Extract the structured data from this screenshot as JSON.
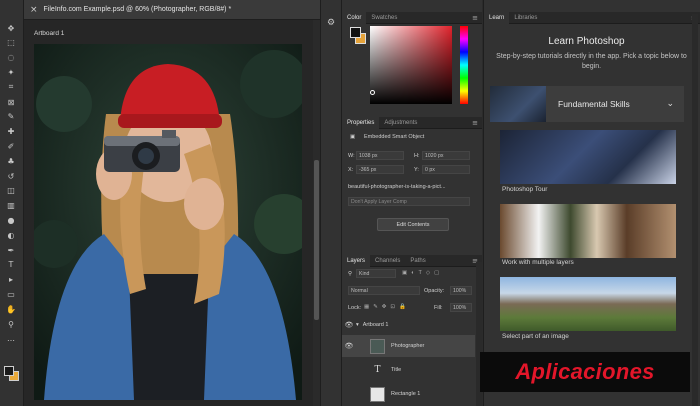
{
  "document": {
    "tab_title": "FileInfo.com Example.psd @ 60% (Photographer, RGB/8#) *",
    "close_glyph": "×",
    "artboard_label": "Artboard 1"
  },
  "toolbar": {
    "tools": [
      "move-icon",
      "marquee-icon",
      "lasso-icon",
      "magic-wand-icon",
      "crop-icon",
      "frame-icon",
      "eyedropper-icon",
      "healing-icon",
      "brush-icon",
      "stamp-icon",
      "history-brush-icon",
      "eraser-icon",
      "gradient-icon",
      "blur-icon",
      "dodge-icon",
      "pen-icon",
      "type-icon",
      "path-select-icon",
      "rectangle-icon",
      "hand-icon",
      "zoom-icon",
      "more-icon"
    ],
    "glyphs": [
      "✥",
      "⬚",
      "◌",
      "✦",
      "⌗",
      "⊠",
      "✎",
      "✚",
      "✐",
      "♣",
      "↺",
      "◫",
      "▥",
      "●",
      "◐",
      "✒",
      "T",
      "▸",
      "▭",
      "✋",
      "⚲",
      "…"
    ],
    "foreground_color": "#1a1a1a",
    "background_color": "#e8a93a"
  },
  "color_panel": {
    "tabs": [
      "Color",
      "Swatches"
    ],
    "foreground": "#111111",
    "background": "#e5a33a",
    "picker_hue": "#e0232c"
  },
  "properties_panel": {
    "tabs": [
      "Properties",
      "Adjustments"
    ],
    "object_type": "Embedded Smart Object",
    "w_label": "W:",
    "w_value": "1038 px",
    "h_label": "H:",
    "h_value": "1020 px",
    "x_label": "X:",
    "x_value": "-365 px",
    "y_label": "Y:",
    "y_value": "0 px",
    "filename": "beautiful-photographer-is-taking-a-pict...",
    "layer_comps_placeholder": "Don't Apply Layer Comp",
    "edit_button": "Edit Contents"
  },
  "layers_panel": {
    "tabs": [
      "Layers",
      "Channels",
      "Paths"
    ],
    "filter_kind": "Kind",
    "blend_mode": "Normal",
    "opacity_label": "Opacity:",
    "opacity_value": "100%",
    "lock_label": "Lock:",
    "fill_label": "Fill:",
    "fill_value": "100%",
    "layers": [
      {
        "name": "Artboard 1",
        "kind": "artboard",
        "visible": true
      },
      {
        "name": "Photographer",
        "kind": "smart-object",
        "visible": true,
        "selected": true
      },
      {
        "name": "Title",
        "kind": "type",
        "visible": false
      },
      {
        "name": "Rectangle 1",
        "kind": "shape",
        "visible": false
      }
    ]
  },
  "learn_panel": {
    "tabs": [
      "Learn",
      "Libraries"
    ],
    "title": "Learn Photoshop",
    "description": "Step-by-step tutorials directly in the app. Pick a topic below to begin.",
    "section": "Fundamental Skills",
    "tutorials": [
      "Photoshop Tour",
      "Work with multiple layers",
      "Select part of an image"
    ]
  },
  "watermark": {
    "text": "Aplicaciones",
    "color": "#e3162a"
  }
}
